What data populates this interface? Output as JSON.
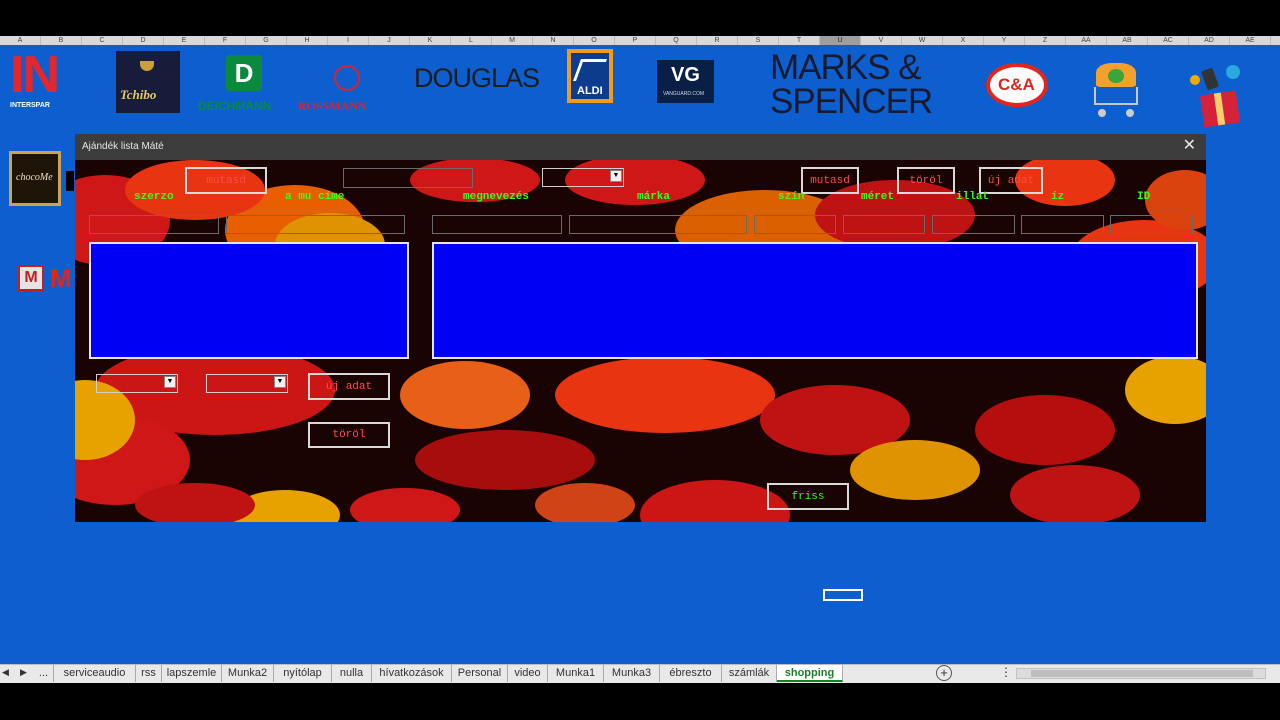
{
  "columns": [
    "A",
    "B",
    "C",
    "D",
    "E",
    "F",
    "G",
    "H",
    "I",
    "J",
    "K",
    "L",
    "M",
    "N",
    "O",
    "P",
    "Q",
    "R",
    "S",
    "T",
    "U",
    "V",
    "W",
    "X",
    "Y",
    "Z",
    "AA",
    "AB",
    "AC",
    "AD",
    "AE"
  ],
  "selected_column": "U",
  "logos": {
    "interspar": "IN",
    "interspar_sub": "INTERSPAR",
    "tchibo": "Tchibo",
    "deichmann_mark": "D",
    "deichmann": "DEICHMANN",
    "rossmann": "ROSSMANN",
    "douglas": "DOUGLAS",
    "aldi": "ALDI",
    "vanguard_mark": "VG",
    "vanguard": "VANGUARD.COM",
    "ms_line1": "MARKS &",
    "ms_line2": "SPENCER",
    "ca": "C&A",
    "chocome": "chocoMe",
    "media_m": "M"
  },
  "dialog": {
    "title": "Ajándék lista Máté",
    "close_icon": "close-icon",
    "buttons": {
      "mutasd_left": "mutasd",
      "mutasd_right": "mutasd",
      "torol_top": "töröl",
      "uj_adat_top": "új adat",
      "uj_adat_bottom": "új adat",
      "torol_bottom": "töröl",
      "frissit": "friss"
    },
    "labels": {
      "szerzo": "szerzo",
      "a_mu_cime": "a mu címe",
      "megnevezes": "megnevezés",
      "marka": "márka",
      "szin": "szín",
      "meret": "méret",
      "illat": "illat",
      "iz": "íz",
      "id": "ID"
    },
    "colors": {
      "label": "#39ff14",
      "button_text": "#ff4a4a",
      "listbox": "#0000f5"
    }
  },
  "sheet_tabs": [
    "...",
    "serviceaudio",
    "rss",
    "lapszemle",
    "Munka2",
    "nyítólap",
    "nulla",
    "hívatkozások",
    "Personal",
    "video",
    "Munka1",
    "Munka3",
    "ébreszto",
    "számlák",
    "shopping"
  ],
  "active_tab": "shopping",
  "nav_icons": [
    "tab-scroll-left-icon",
    "tab-scroll-right-icon",
    "add-sheet-icon"
  ]
}
